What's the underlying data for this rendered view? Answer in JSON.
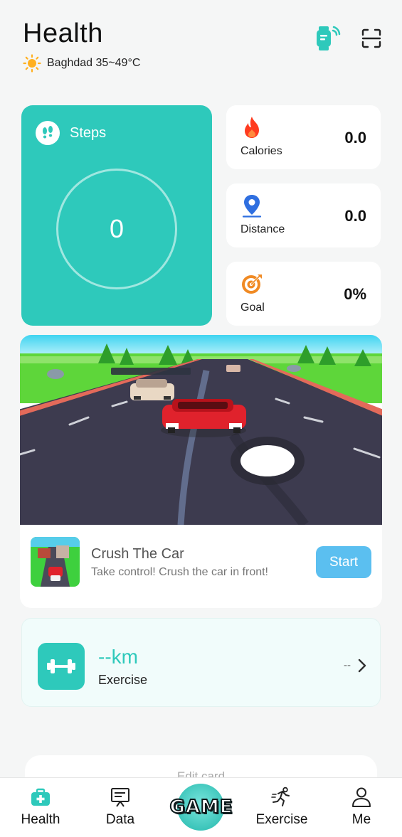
{
  "header": {
    "title": "Health",
    "weather": "Baghdad 35~49°C"
  },
  "steps": {
    "label": "Steps",
    "value": "0"
  },
  "metrics": [
    {
      "label": "Calories",
      "value": "0.0",
      "icon": "flame-icon",
      "color": "#ff3b1f"
    },
    {
      "label": "Distance",
      "value": "0.0",
      "icon": "location-pin-icon",
      "color": "#2f6fe0"
    },
    {
      "label": "Goal",
      "value": "0%",
      "icon": "target-icon",
      "color": "#f08a24"
    }
  ],
  "game": {
    "name": "Crush The Car",
    "description": "Take control! Crush the car in front!",
    "start_label": "Start"
  },
  "exercise": {
    "distance": "--km",
    "label": "Exercise",
    "detail": "--"
  },
  "edit_card": {
    "label": "Edit card"
  },
  "nav": {
    "items": [
      {
        "label": "Health",
        "active": true
      },
      {
        "label": "Data"
      },
      {
        "label": "GAME"
      },
      {
        "label": "Exercise"
      },
      {
        "label": "Me"
      }
    ]
  },
  "colors": {
    "accent": "#2ec9bb",
    "start_button": "#5bbff0"
  }
}
